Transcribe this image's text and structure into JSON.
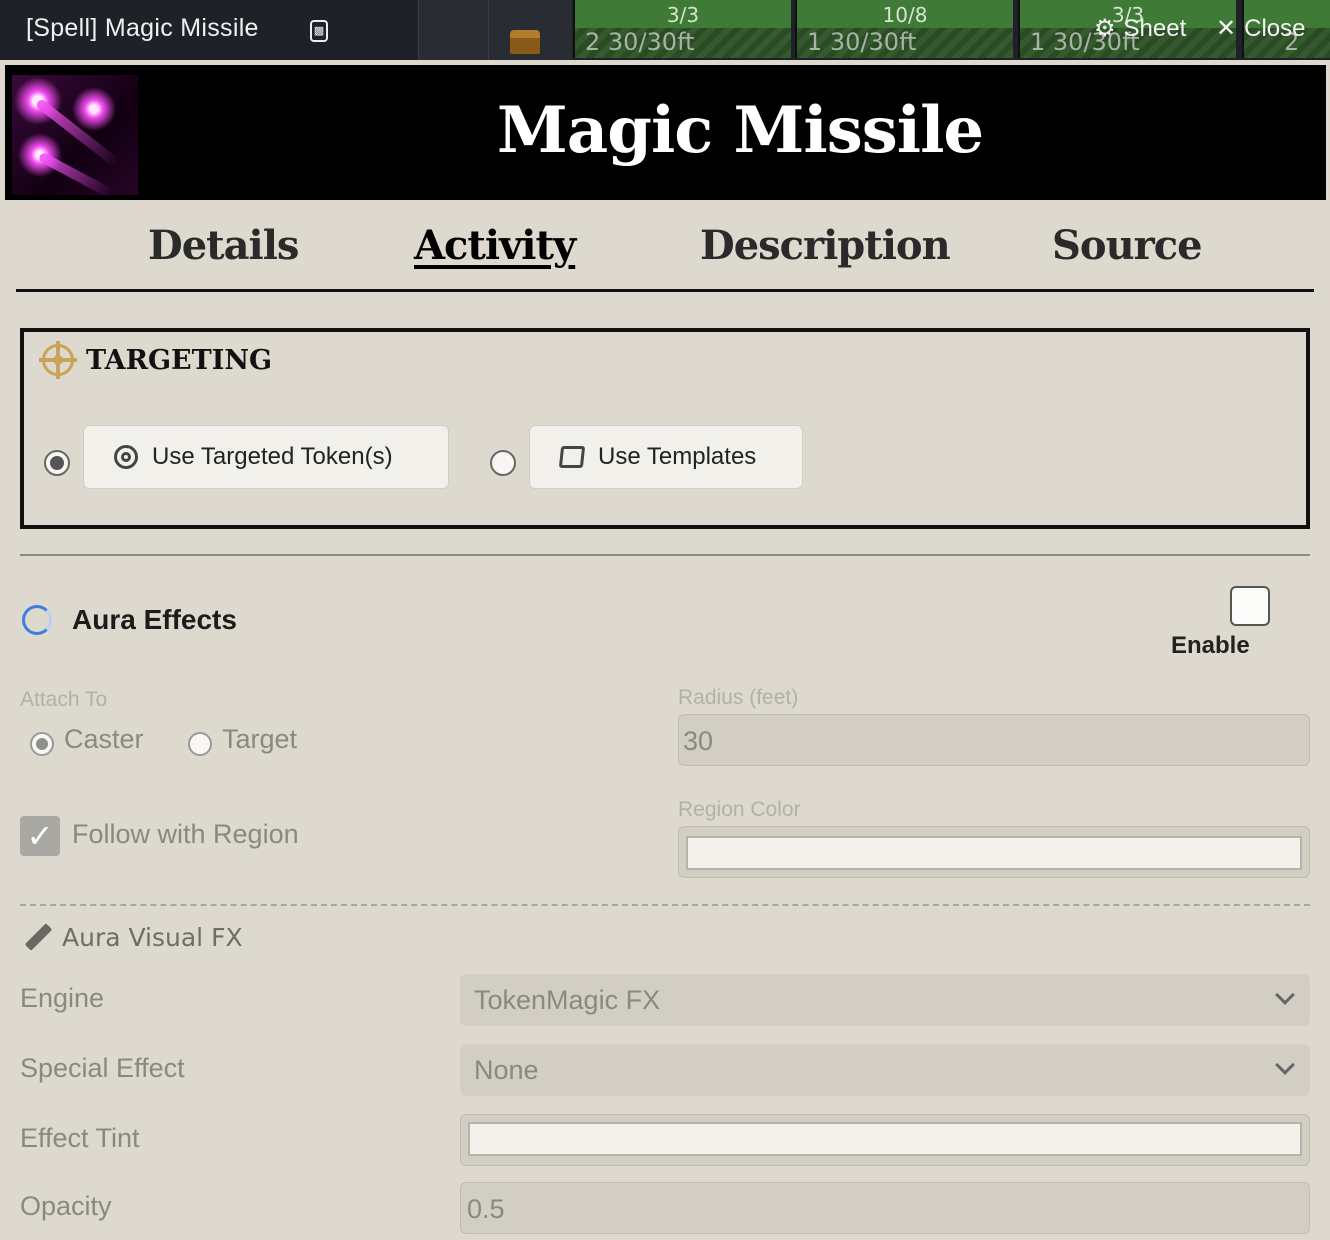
{
  "window": {
    "title": "[Spell] Magic Missile",
    "sheet_label": "Sheet",
    "close_label": "Close"
  },
  "background_tokens": [
    {
      "top": "3/3",
      "bottom": "2   30/30ft"
    },
    {
      "top": "10/8",
      "bottom": "1   30/30ft"
    },
    {
      "top": "3/3",
      "bottom": "1   30/30ft"
    },
    {
      "top": "",
      "bottom": "2"
    }
  ],
  "banner": {
    "spell_name": "Magic Missile"
  },
  "tabs": [
    {
      "label": "Details",
      "active": false
    },
    {
      "label": "Activity",
      "active": true
    },
    {
      "label": "Description",
      "active": false
    },
    {
      "label": "Source",
      "active": false
    }
  ],
  "targeting": {
    "title": "TARGETING",
    "options": [
      {
        "label": "Use Targeted Token(s)",
        "selected": true
      },
      {
        "label": "Use Templates",
        "selected": false
      }
    ]
  },
  "aura": {
    "title": "Aura Effects",
    "enable_label": "Enable",
    "enabled": false,
    "attach_to_label": "Attach To",
    "attach_options": [
      {
        "label": "Caster",
        "selected": true
      },
      {
        "label": "Target",
        "selected": false
      }
    ],
    "radius_label": "Radius (feet)",
    "radius_value": "30",
    "follow_label": "Follow with Region",
    "follow_checked": true,
    "region_color_label": "Region Color",
    "region_color_value": "#f2f1ec"
  },
  "visual_fx": {
    "title": "Aura Visual FX",
    "engine_label": "Engine",
    "engine_value": "TokenMagic FX",
    "special_effect_label": "Special Effect",
    "special_effect_value": "None",
    "effect_tint_label": "Effect Tint",
    "effect_tint_value": "#f2f1ec",
    "opacity_label": "Opacity",
    "opacity_value": "0.5"
  },
  "colors": {
    "parchment": "#ddd9cf",
    "header_bg": "#1f2128",
    "accent_gold": "#c8a35a",
    "spinner_blue": "#3d7de0"
  }
}
